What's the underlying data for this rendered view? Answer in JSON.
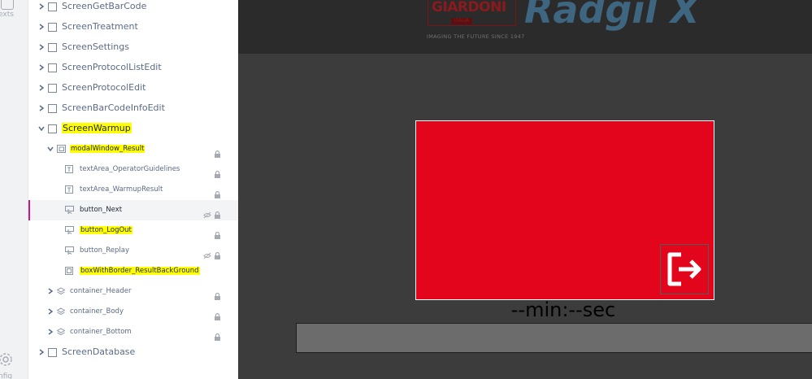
{
  "rail": {
    "texts_label": "exts",
    "config_label": "nfig"
  },
  "tree": [
    {
      "label": "ScreenGetBarCode",
      "level": 0,
      "expanded": false,
      "highlighted": false
    },
    {
      "label": "ScreenTreatment",
      "level": 0,
      "expanded": false,
      "highlighted": false
    },
    {
      "label": "ScreenSettings",
      "level": 0,
      "expanded": false,
      "highlighted": false
    },
    {
      "label": "ScreenProtocolListEdit",
      "level": 0,
      "expanded": false,
      "highlighted": false
    },
    {
      "label": "ScreenProtocolEdit",
      "level": 0,
      "expanded": false,
      "highlighted": false
    },
    {
      "label": "ScreenBarCodeInfoEdit",
      "level": 0,
      "expanded": false,
      "highlighted": false
    },
    {
      "label": "ScreenWarmup",
      "level": 0,
      "expanded": true,
      "highlighted": true
    },
    {
      "label": "modalWindow_Result",
      "level": 1,
      "expanded": true,
      "highlighted": true,
      "icon": "window-icon",
      "locked": true
    },
    {
      "label": "textArea_OperatorGuidelines",
      "level": 2,
      "highlighted": false,
      "icon": "text-icon",
      "locked": true
    },
    {
      "label": "textArea_WarmupResult",
      "level": 2,
      "highlighted": false,
      "icon": "text-icon",
      "locked": true
    },
    {
      "label": "button_Next",
      "level": 2,
      "highlighted": false,
      "icon": "button-icon",
      "locked": true,
      "hidden": true,
      "selected": true
    },
    {
      "label": "button_LogOut",
      "level": 2,
      "highlighted": true,
      "icon": "button-icon",
      "locked": true
    },
    {
      "label": "button_Replay",
      "level": 2,
      "highlighted": false,
      "icon": "button-icon",
      "locked": true,
      "hidden": true
    },
    {
      "label": "boxWithBorder_ResultBackGround",
      "level": 2,
      "highlighted": true,
      "icon": "box-icon",
      "locked": false
    },
    {
      "label": "container_Header",
      "level": 1,
      "expanded": false,
      "highlighted": false,
      "icon": "layers-icon",
      "locked": true
    },
    {
      "label": "container_Body",
      "level": 1,
      "expanded": false,
      "highlighted": false,
      "icon": "layers-icon",
      "locked": true
    },
    {
      "label": "container_Bottom",
      "level": 1,
      "expanded": false,
      "highlighted": false,
      "icon": "layers-icon",
      "locked": true
    },
    {
      "label": "ScreenDatabase",
      "level": 0,
      "expanded": false,
      "highlighted": false
    }
  ],
  "header": {
    "brand_name": "GIARDONI",
    "brand_sub": "ITALIA",
    "tagline": "IMAGING THE FUTURE SINCE 1947",
    "product_name": "Radgil X"
  },
  "timer": "--min:--sec",
  "colors": {
    "highlight": "#ffff00",
    "result_box": "#e3051b",
    "selection_bar": "#c4198a",
    "canvas_bg": "#3c3c3c",
    "header_bg": "#2b2b2b",
    "product": "#3f6680"
  }
}
